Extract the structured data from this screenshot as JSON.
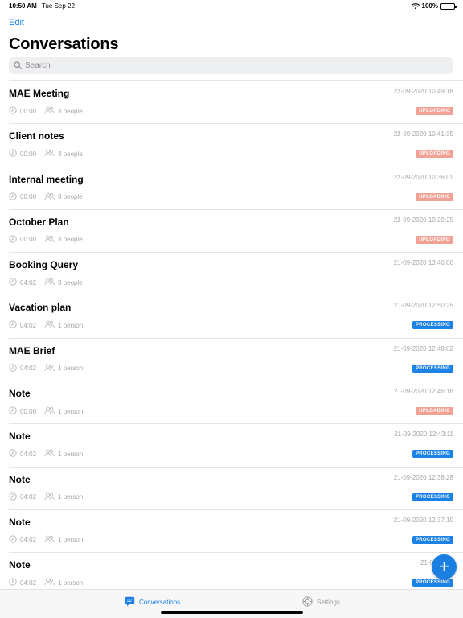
{
  "status": {
    "time": "10:50 AM",
    "date": "Tue Sep 22",
    "battery": "100%"
  },
  "nav": {
    "edit_label": "Edit",
    "title": "Conversations"
  },
  "search": {
    "placeholder": "Search"
  },
  "conversations": [
    {
      "title": "MAE Meeting",
      "timestamp": "22-09-2020 10:49:18",
      "duration": "00:00",
      "people": "3 people",
      "status": "UPLOADING"
    },
    {
      "title": "Client notes",
      "timestamp": "22-09-2020 10:41:35",
      "duration": "00:00",
      "people": "3 people",
      "status": "UPLOADING"
    },
    {
      "title": "Internal meeting",
      "timestamp": "22-09-2020 10:36:01",
      "duration": "00:00",
      "people": "3 people",
      "status": "UPLOADING"
    },
    {
      "title": "October Plan",
      "timestamp": "22-09-2020 10:29:25",
      "duration": "00:00",
      "people": "3 people",
      "status": "UPLOADING"
    },
    {
      "title": "Booking Query",
      "timestamp": "21-09-2020 13:46:00",
      "duration": "04:02",
      "people": "3 people",
      "status": ""
    },
    {
      "title": "Vacation plan",
      "timestamp": "21-09-2020 12:50:25",
      "duration": "04:02",
      "people": "1 person",
      "status": "PROCESSING"
    },
    {
      "title": "MAE Brief",
      "timestamp": "21-09-2020 12:48:02",
      "duration": "04:02",
      "people": "1 person",
      "status": "PROCESSING"
    },
    {
      "title": "Note",
      "timestamp": "21-09-2020 12:46:16",
      "duration": "00:00",
      "people": "1 person",
      "status": "UPLOADING"
    },
    {
      "title": "Note",
      "timestamp": "21-09-2020 12:43:11",
      "duration": "04:02",
      "people": "1 person",
      "status": "PROCESSING"
    },
    {
      "title": "Note",
      "timestamp": "21-09-2020 12:38:28",
      "duration": "04:02",
      "people": "1 person",
      "status": "PROCESSING"
    },
    {
      "title": "Note",
      "timestamp": "21-09-2020 12:37:10",
      "duration": "04:02",
      "people": "1 person",
      "status": "PROCESSING"
    },
    {
      "title": "Note",
      "timestamp": "21-09-2020",
      "duration": "04:02",
      "people": "1 person",
      "status": "PROCESSING"
    }
  ],
  "fab": {
    "label": "+"
  },
  "tabs": {
    "conversations": "Conversations",
    "settings": "Settings"
  },
  "colors": {
    "accent": "#1a7fe0",
    "uploading": "#f2a195",
    "processing": "#1c82e6"
  },
  "icons": {
    "wifi": "wifi-icon",
    "battery": "battery-icon",
    "search": "search-icon",
    "duration": "clock-icon",
    "people": "people-icon",
    "add": "plus-icon",
    "conversations_tab": "chat-bubble-icon",
    "settings_tab": "gear-icon"
  }
}
